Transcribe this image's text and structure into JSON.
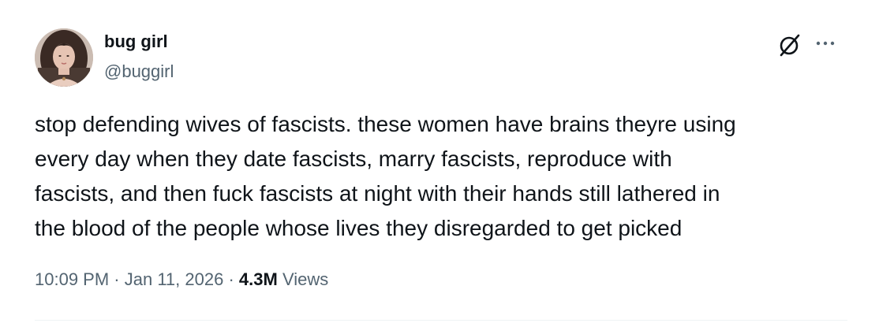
{
  "author": {
    "display_name": "bug girl",
    "handle": "@buggirl"
  },
  "icons": {
    "avatar": "avatar-photo",
    "grok": "grok-slash-circle-icon",
    "more": "more-horizontal-dots-icon"
  },
  "tweet": {
    "text": "stop defending wives of fascists. these women have brains theyre using\nevery day when they date fascists, marry fascists, reproduce with\nfascists, and then fuck fascists at night with their hands still lathered in\nthe blood of the people whose lives they disregarded to get picked",
    "time": "10:09 PM",
    "separator": "·",
    "date": "Jan 11, 2026",
    "views_count": "4.3M",
    "views_label": "Views"
  },
  "colors": {
    "text_primary": "#0f1419",
    "text_secondary": "#536471",
    "divider": "#eff3f4"
  }
}
